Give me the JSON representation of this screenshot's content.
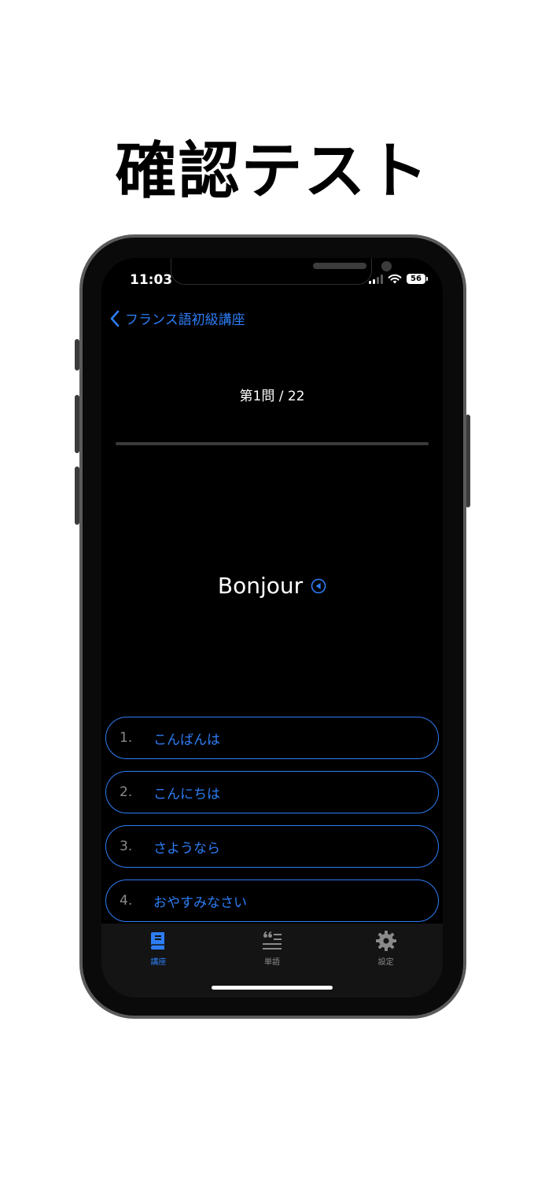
{
  "promo": {
    "title": "確認テスト"
  },
  "status_bar": {
    "time": "11:03",
    "battery": "56"
  },
  "nav": {
    "back_label": "フランス語初級講座"
  },
  "quiz": {
    "counter": "第1問 / 22",
    "progress_fraction": 0.0,
    "question_word": "Bonjour",
    "choices": [
      {
        "number": "1.",
        "text": "こんばんは"
      },
      {
        "number": "2.",
        "text": "こんにちは"
      },
      {
        "number": "3.",
        "text": "さようなら"
      },
      {
        "number": "4.",
        "text": "おやすみなさい"
      }
    ]
  },
  "tab_bar": {
    "tabs": [
      {
        "label": "講座",
        "icon": "book-icon",
        "active": true
      },
      {
        "label": "単語",
        "icon": "quote-list-icon",
        "active": false
      },
      {
        "label": "設定",
        "icon": "gear-icon",
        "active": false
      }
    ]
  },
  "colors": {
    "accent": "#2d7df5",
    "background": "#000000",
    "tab_bar": "#141414",
    "inactive_tab": "#8a8a8a"
  }
}
